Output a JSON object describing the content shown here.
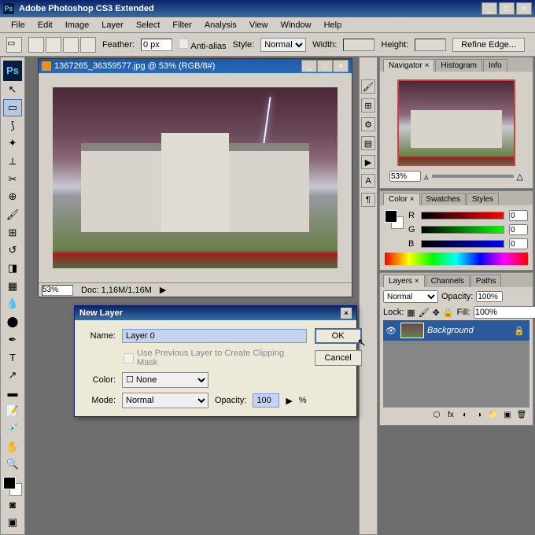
{
  "app": {
    "title": "Adobe Photoshop CS3 Extended"
  },
  "menu": [
    "File",
    "Edit",
    "Image",
    "Layer",
    "Select",
    "Filter",
    "Analysis",
    "View",
    "Window",
    "Help"
  ],
  "options": {
    "feather_label": "Feather:",
    "feather_value": "0 px",
    "antialias": "Anti-alias",
    "style_label": "Style:",
    "style_value": "Normal",
    "width_label": "Width:",
    "height_label": "Height:",
    "refine": "Refine Edge..."
  },
  "document": {
    "title": "1367265_36359577.jpg @ 53% (RGB/8#)",
    "zoom": "53%",
    "doc_size": "Doc: 1,16M/1,16M"
  },
  "dialog": {
    "title": "New Layer",
    "name_label": "Name:",
    "name_value": "Layer 0",
    "clip_mask": "Use Previous Layer to Create Clipping Mask",
    "color_label": "Color:",
    "color_value": "None",
    "mode_label": "Mode:",
    "mode_value": "Normal",
    "opacity_label": "Opacity:",
    "opacity_value": "100",
    "pct": "%",
    "ok": "OK",
    "cancel": "Cancel"
  },
  "nav": {
    "tabs": [
      "Navigator ×",
      "Histogram",
      "Info"
    ],
    "zoom": "53%"
  },
  "color": {
    "tabs": [
      "Color ×",
      "Swatches",
      "Styles"
    ],
    "r": "R",
    "g": "G",
    "b": "B",
    "r_val": "0",
    "g_val": "0",
    "b_val": "0"
  },
  "layers": {
    "tabs": [
      "Layers ×",
      "Channels",
      "Paths"
    ],
    "blend": "Normal",
    "opacity_label": "Opacity:",
    "opacity": "100%",
    "lock_label": "Lock:",
    "fill_label": "Fill:",
    "fill": "100%",
    "item": "Background"
  }
}
